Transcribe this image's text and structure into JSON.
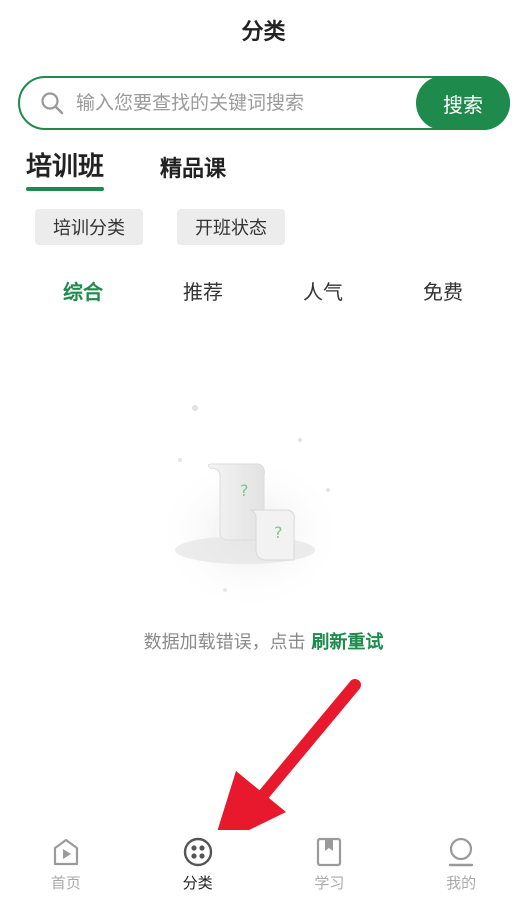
{
  "header": {
    "title": "分类"
  },
  "search": {
    "placeholder": "输入您要查找的关键词搜索",
    "button_label": "搜索"
  },
  "main_tabs": [
    {
      "label": "培训班",
      "active": true
    },
    {
      "label": "精品课",
      "active": false
    }
  ],
  "filters": [
    {
      "label": "培训分类"
    },
    {
      "label": "开班状态"
    }
  ],
  "sort_tabs": [
    {
      "label": "综合",
      "active": true
    },
    {
      "label": "推荐",
      "active": false
    },
    {
      "label": "人气",
      "active": false
    },
    {
      "label": "免费",
      "active": false
    }
  ],
  "empty_state": {
    "message": "数据加载错误，点击 ",
    "retry_label": "刷新重试"
  },
  "tabbar": [
    {
      "label": "首页",
      "icon": "home-play-icon",
      "active": false
    },
    {
      "label": "分类",
      "icon": "category-icon",
      "active": true
    },
    {
      "label": "学习",
      "icon": "study-bookmark-icon",
      "active": false
    },
    {
      "label": "我的",
      "icon": "profile-icon",
      "active": false
    }
  ],
  "colors": {
    "accent": "#1e8a4c",
    "arrow": "#e8192c"
  }
}
